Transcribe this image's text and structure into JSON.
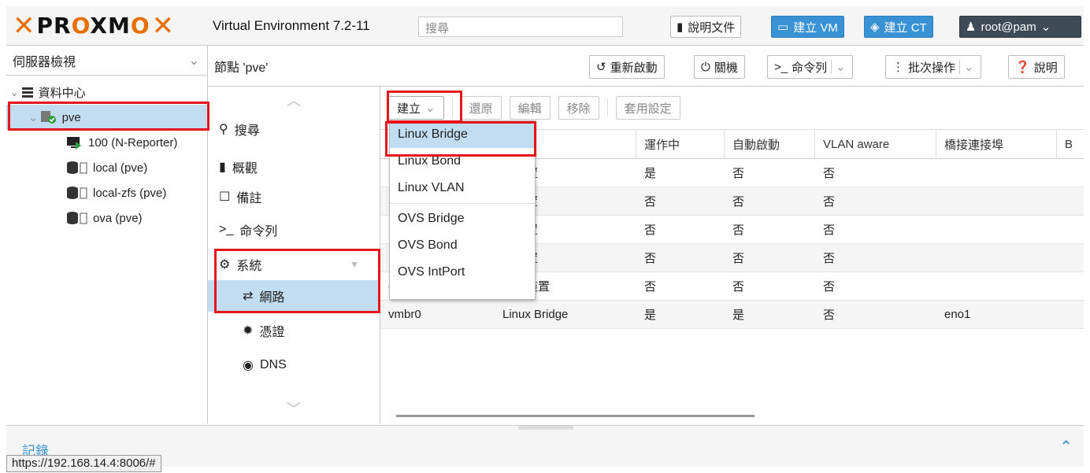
{
  "brand": {
    "logo": "PROXMOX",
    "version": "Virtual Environment 7.2-11"
  },
  "search": {
    "placeholder": "搜尋"
  },
  "topbar": {
    "docs": "說明文件",
    "create_vm": "建立 VM",
    "create_ct": "建立 CT",
    "user": "root@pam"
  },
  "left": {
    "view": "伺服器檢視",
    "datacenter": "資料中心",
    "node": "pve",
    "items": [
      "100 (N-Reporter)",
      "local (pve)",
      "local-zfs (pve)",
      "ova (pve)"
    ]
  },
  "node": {
    "title": "節點 'pve'",
    "reboot": "重新啟動",
    "shutdown": "關機",
    "shell": "命令列",
    "bulk": "批次操作",
    "help": "說明"
  },
  "nav": {
    "search": "搜尋",
    "summary": "概觀",
    "notes": "備註",
    "shell": "命令列",
    "system": "系統",
    "network": "網路",
    "certs": "憑證",
    "dns": "DNS"
  },
  "toolbar": {
    "create": "建立",
    "revert": "還原",
    "edit": "編輯",
    "remove": "移除",
    "apply": "套用設定"
  },
  "menu": {
    "items": [
      "Linux Bridge",
      "Linux Bond",
      "Linux VLAN",
      "OVS Bridge",
      "OVS Bond",
      "OVS IntPort"
    ]
  },
  "table": {
    "headers": [
      "",
      "",
      "運作中",
      "自動啟動",
      "VLAN aware",
      "橋接連接埠",
      "B"
    ],
    "rows": [
      [
        "",
        "路裝置",
        "是",
        "否",
        "否",
        ""
      ],
      [
        "",
        "路裝置",
        "否",
        "否",
        "否",
        ""
      ],
      [
        "",
        "路裝置",
        "否",
        "否",
        "否",
        ""
      ],
      [
        "",
        "路裝置",
        "否",
        "否",
        "否",
        ""
      ],
      [
        "enp1s0f3",
        "網路裝置",
        "否",
        "否",
        "否",
        ""
      ],
      [
        "vmbr0",
        "Linux Bridge",
        "是",
        "是",
        "否",
        "eno1"
      ]
    ]
  },
  "log": {
    "title": "記錄"
  },
  "status": {
    "url": "https://192.168.14.4:8006/#"
  },
  "colors": {
    "accent": "#e57000",
    "blue": "#3892d4",
    "highlight_red": "#e3161c",
    "selected": "#c2ddf2"
  }
}
